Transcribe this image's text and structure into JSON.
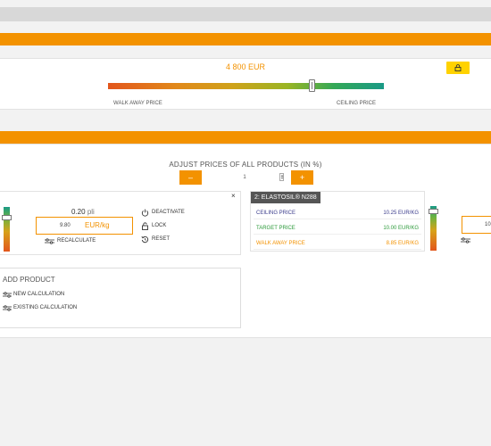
{
  "summary": {
    "total_price": "4 800 EUR",
    "walk_away_label": "WALK AWAY PRICE",
    "ceiling_label": "CEILING PRICE",
    "slider_position": 0.74,
    "colors": {
      "accent": "#f39200",
      "lock_badge": "#ffd200"
    }
  },
  "adjust": {
    "title": "ADJUST PRICES OF ALL PRODUCTS (IN %)",
    "minus_label": "–",
    "plus_label": "+",
    "value": "1"
  },
  "product1": {
    "close_label": "×",
    "pli_value": "0.20",
    "pli_unit": "pli",
    "price_value": "9.80",
    "price_unit": "EUR/kg",
    "recalculate_label": "RECALCULATE",
    "actions": {
      "deactivate": "DEACTIVATE",
      "lock": "LOCK",
      "reset": "RESET"
    }
  },
  "product2": {
    "title": "2: ELASTOSIL® N288",
    "rows": {
      "ceiling": {
        "label": "CEILING PRICE",
        "value": "10.25 EUR/KG",
        "color": "#3b3c8c"
      },
      "target": {
        "label": "TARGET PRICE",
        "value": "10.00 EUR/KG",
        "color": "#2c9a3a"
      },
      "walk_away": {
        "label": "WALK AWAY PRICE",
        "value": "8.85 EUR/KG",
        "color": "#f39200"
      }
    }
  },
  "product3": {
    "price_value_partial": "10"
  },
  "add_product": {
    "title": "ADD PRODUCT",
    "new_calculation": "NEW CALCULATION",
    "existing_calculation": "EXISTING CALCULATION"
  }
}
